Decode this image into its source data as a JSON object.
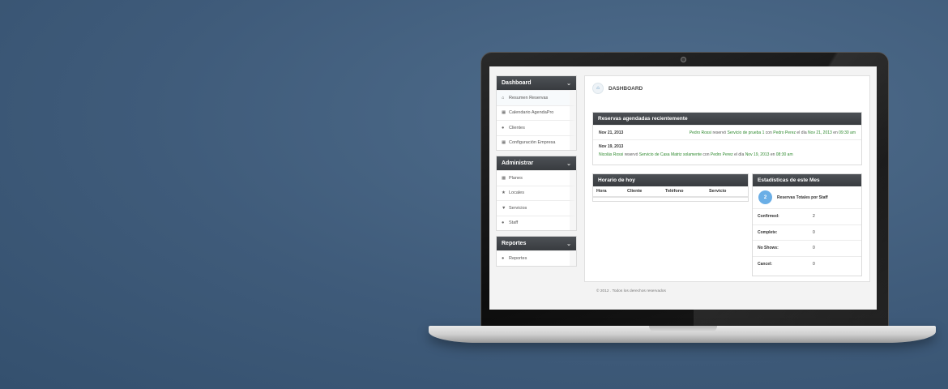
{
  "sidebar": {
    "sections": [
      {
        "title": "Dashboard",
        "items": [
          {
            "label": "Resumen Reservas",
            "icon": "home-icon"
          },
          {
            "label": "Calendario AgendaPro",
            "icon": "calendar-icon"
          },
          {
            "label": "Clientes",
            "icon": "user-icon"
          },
          {
            "label": "Configuración Empresa",
            "icon": "calendar-icon"
          }
        ]
      },
      {
        "title": "Administrar",
        "items": [
          {
            "label": "Planes",
            "icon": "calendar-icon"
          },
          {
            "label": "Locales",
            "icon": "star-icon"
          },
          {
            "label": "Servicios",
            "icon": "shield-icon"
          },
          {
            "label": "Staff",
            "icon": "user-icon"
          }
        ]
      },
      {
        "title": "Reportes",
        "items": [
          {
            "label": "Reportes",
            "icon": "user-icon"
          }
        ]
      }
    ]
  },
  "main": {
    "title": "DASHBOARD",
    "recent": {
      "title": "Reservas agendadas recientemente",
      "rows": [
        {
          "date": "Nov 21, 2013",
          "client": "Pedro Rossi",
          "verb": "reservó",
          "service": "Servicio de prueba 1",
          "with": "con",
          "staff": "Pedro Perez",
          "on": "el día",
          "datetime": "Nov 21, 2013",
          "at": "en",
          "time": "09:30 am"
        },
        {
          "date": "Nov 19, 2013",
          "client": "Nicolás Rossi",
          "verb": "reservó",
          "service": "Servicio de Casa Matriz solamente",
          "with": "con",
          "staff": "Pedro Perez",
          "on": "el día",
          "datetime": "Nov 19, 2013",
          "at": "en",
          "time": "08:30 am"
        }
      ]
    },
    "schedule": {
      "title": "Horario de hoy",
      "columns": [
        "Hora",
        "Cliente",
        "Teléfono",
        "Servicio"
      ]
    },
    "stats": {
      "title": "Estadísticas de este Mes",
      "total": "2",
      "total_label": "Reservas Totales por Staff",
      "rows": [
        {
          "label": "Confirmed:",
          "value": "2"
        },
        {
          "label": "Complete:",
          "value": "0"
        },
        {
          "label": "No Shows:",
          "value": "0"
        },
        {
          "label": "Cancel:",
          "value": "0"
        }
      ]
    }
  },
  "footer": "© 2012 . Todos los derechos reservados"
}
